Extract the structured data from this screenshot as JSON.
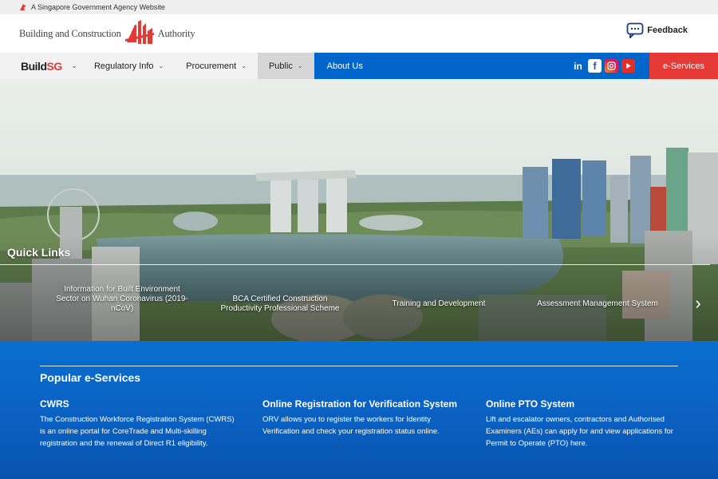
{
  "govbar": {
    "text": "A Singapore Government Agency Website"
  },
  "header": {
    "logo_left": "Building and Construction",
    "logo_right": "Authority",
    "feedback_label": "Feedback"
  },
  "nav": {
    "brand_a": "Build",
    "brand_b": "SG",
    "items": [
      {
        "label": "Regulatory Info"
      },
      {
        "label": "Procurement"
      },
      {
        "label": "Public"
      },
      {
        "label": "About Us"
      }
    ],
    "social": [
      "linkedin-icon",
      "facebook-icon",
      "instagram-icon",
      "youtube-icon"
    ],
    "eservices_label": "e-Services",
    "colors": {
      "blue": "#0066cc",
      "red": "#e53935"
    }
  },
  "quick_links": {
    "title": "Quick Links",
    "items": [
      {
        "label": "Information for Built Environment Sector on Wuhan Coronavirus (2019-nCoV)"
      },
      {
        "label": "BCA Certified Construction Productivity Professional Scheme"
      },
      {
        "label": "Training and Development"
      },
      {
        "label": "Assessment Management System"
      }
    ]
  },
  "popular": {
    "title": "Popular e-Services",
    "services": [
      {
        "title": "CWRS",
        "desc": "The Construction Workforce Registration System (CWRS) is an online portal for CoreTrade and Multi-skilling registration and the renewal of Direct R1 eligibility."
      },
      {
        "title": "Online Registration for Verification System",
        "desc": "ORV allows you to register the workers for Identity Verification and check your registration status online."
      },
      {
        "title": "Online PTO System",
        "desc": "Lift and escalator owners, contractors and Authorised Examiners (AEs) can apply for and view applications for Permit to Operate (PTO) here."
      }
    ]
  }
}
